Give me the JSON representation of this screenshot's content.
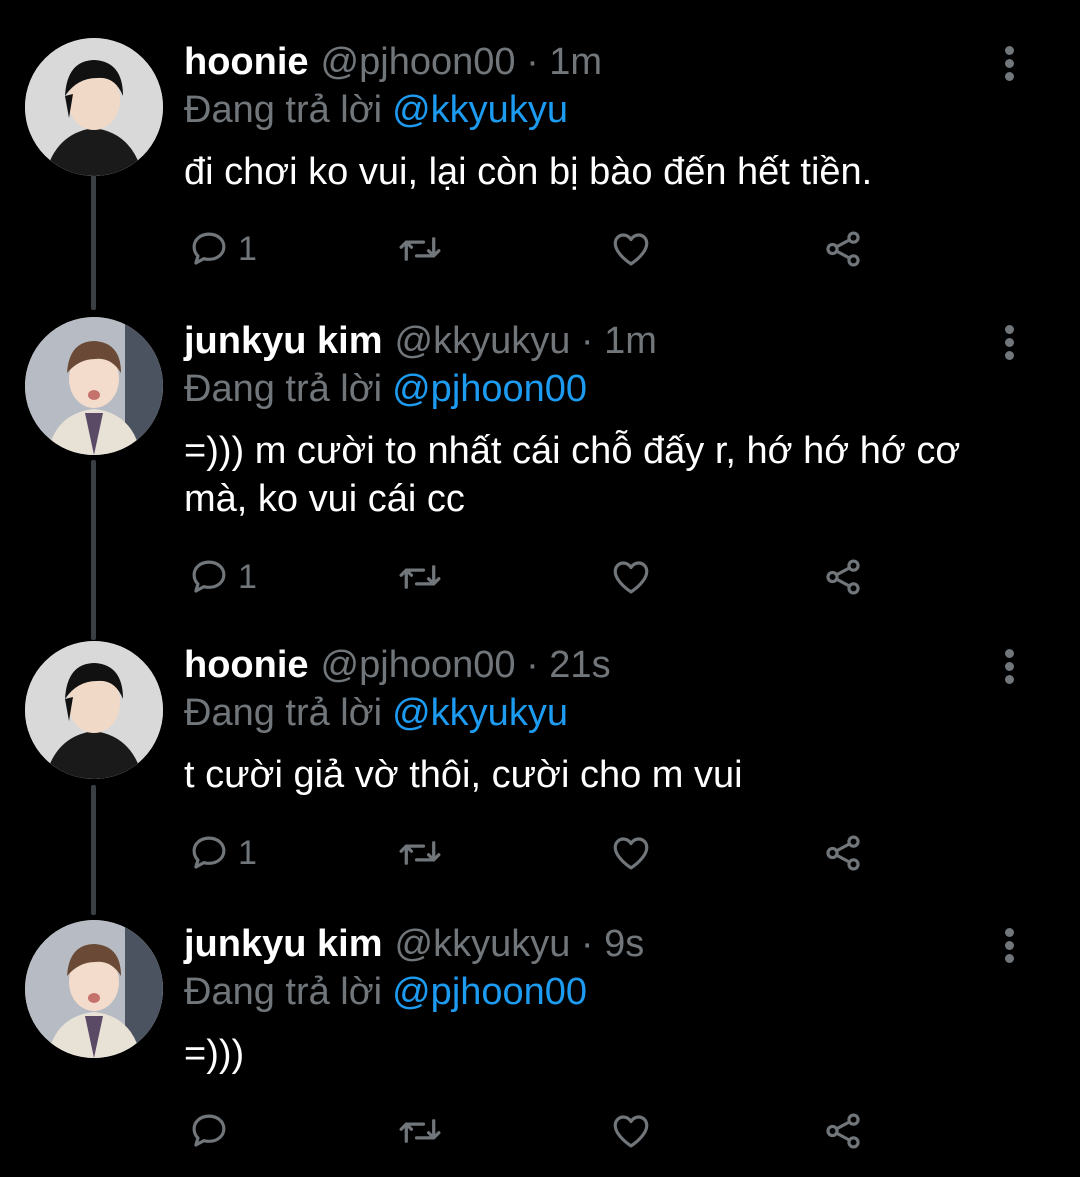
{
  "colors": {
    "background": "#000000",
    "name": "#ffffff",
    "muted": "#71767b",
    "mention": "#1d9bf0",
    "thread_line": "#3a3f44"
  },
  "icons": {
    "reply": "speech-bubble-icon",
    "retweet": "retweet-arrows-icon",
    "like": "heart-icon",
    "share": "share-icon",
    "more": "vertical-ellipsis-icon"
  },
  "tweets": [
    {
      "display_name": "hoonie",
      "handle": "@pjhoon00",
      "separator": "·",
      "time": "1m",
      "reply_prefix": "Đang trả lời",
      "reply_to": "@kkyukyu",
      "text": "đi chơi ko vui, lại còn bị bào đến hết tiền.",
      "reply_count": "1"
    },
    {
      "display_name": "junkyu kim",
      "handle": "@kkyukyu",
      "separator": "·",
      "time": "1m",
      "reply_prefix": "Đang trả lời",
      "reply_to": "@pjhoon00",
      "text": "=))) m cười to nhất cái chỗ đấy r, hớ hớ hớ cơ mà, ko vui cái cc",
      "reply_count": "1"
    },
    {
      "display_name": "hoonie",
      "handle": "@pjhoon00",
      "separator": "·",
      "time": "21s",
      "reply_prefix": "Đang trả lời",
      "reply_to": "@kkyukyu",
      "text": "t cười giả vờ thôi, cười cho m vui",
      "reply_count": "1"
    },
    {
      "display_name": "junkyu kim",
      "handle": "@kkyukyu",
      "separator": "·",
      "time": "9s",
      "reply_prefix": "Đang trả lời",
      "reply_to": "@pjhoon00",
      "text": "=)))",
      "reply_count": ""
    }
  ]
}
